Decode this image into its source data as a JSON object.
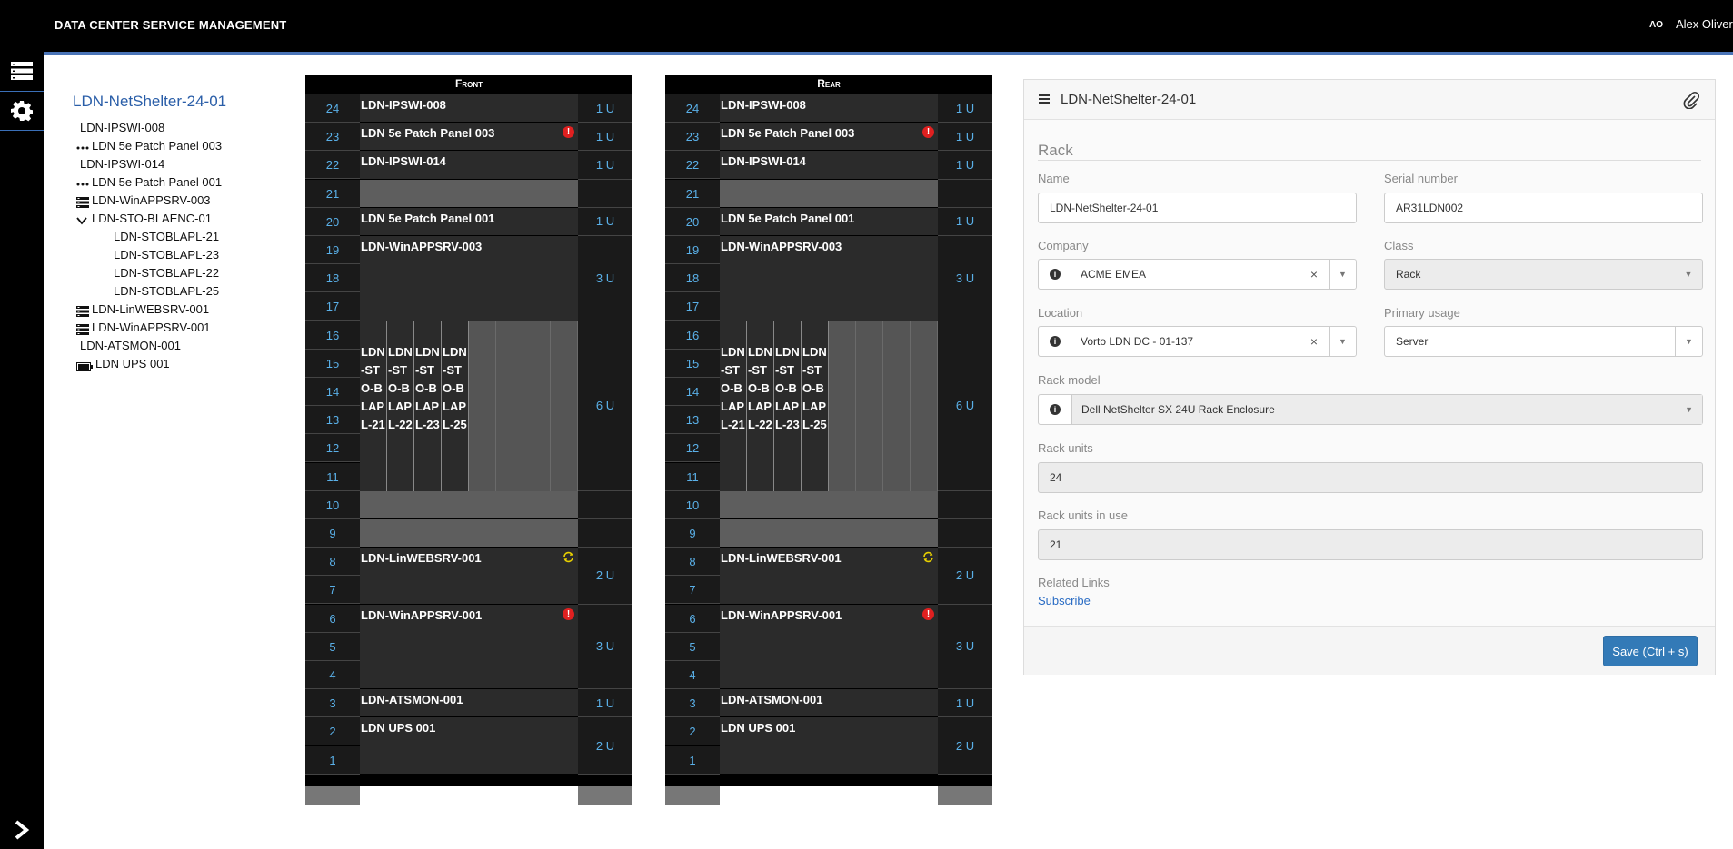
{
  "app": {
    "title": "DATA CENTER SERVICE MANAGEMENT"
  },
  "user": {
    "initials": "AO",
    "name": "Alex Oliver"
  },
  "tree": {
    "title": "LDN-NetShelter-24-01",
    "items": [
      {
        "label": "LDN-IPSWI-008",
        "icon": "none",
        "indent": 0
      },
      {
        "label": "LDN 5e Patch Panel 003",
        "icon": "patch-panel-icon",
        "indent": 0
      },
      {
        "label": "LDN-IPSWI-014",
        "icon": "none",
        "indent": 0
      },
      {
        "label": "LDN 5e Patch Panel 001",
        "icon": "patch-panel-icon",
        "indent": 0
      },
      {
        "label": "LDN-WinAPPSRV-003",
        "icon": "server-icon",
        "indent": 0
      },
      {
        "label": "LDN-STO-BLAENC-01",
        "icon": "chevron-down-icon",
        "indent": 0
      },
      {
        "label": "LDN-STOBLAPL-21",
        "icon": "none",
        "indent": 1
      },
      {
        "label": "LDN-STOBLAPL-23",
        "icon": "none",
        "indent": 1
      },
      {
        "label": "LDN-STOBLAPL-22",
        "icon": "none",
        "indent": 1
      },
      {
        "label": "LDN-STOBLAPL-25",
        "icon": "none",
        "indent": 1
      },
      {
        "label": "LDN-LinWEBSRV-001",
        "icon": "server-icon",
        "indent": 0
      },
      {
        "label": "LDN-WinAPPSRV-001",
        "icon": "server-icon",
        "indent": 0
      },
      {
        "label": "LDN-ATSMON-001",
        "icon": "none",
        "indent": 0
      },
      {
        "label": "LDN UPS 001",
        "icon": "battery-icon",
        "indent": 0
      }
    ]
  },
  "racks": {
    "front": {
      "label": "Front"
    },
    "rear": {
      "label": "Rear"
    },
    "total_units": 24,
    "devices": [
      {
        "name": "LDN-IPSWI-008",
        "top_unit": 24,
        "units": 1,
        "size": "1 U",
        "status": "none"
      },
      {
        "name": "LDN 5e Patch Panel 003",
        "top_unit": 23,
        "units": 1,
        "size": "1 U",
        "status": "error"
      },
      {
        "name": "LDN-IPSWI-014",
        "top_unit": 22,
        "units": 1,
        "size": "1 U",
        "status": "none"
      },
      {
        "name": "",
        "top_unit": 21,
        "units": 1,
        "size": "",
        "status": "empty"
      },
      {
        "name": "LDN 5e Patch Panel 001",
        "top_unit": 20,
        "units": 1,
        "size": "1 U",
        "status": "none"
      },
      {
        "name": "LDN-WinAPPSRV-003",
        "top_unit": 19,
        "units": 3,
        "size": "3 U",
        "status": "none"
      },
      {
        "name": "",
        "top_unit": 16,
        "units": 6,
        "size": "6 U",
        "status": "blade"
      },
      {
        "name": "",
        "top_unit": 10,
        "units": 1,
        "size": "",
        "status": "empty"
      },
      {
        "name": "",
        "top_unit": 9,
        "units": 1,
        "size": "",
        "status": "empty"
      },
      {
        "name": "LDN-LinWEBSRV-001",
        "top_unit": 8,
        "units": 2,
        "size": "2 U",
        "status": "sync"
      },
      {
        "name": "LDN-WinAPPSRV-001",
        "top_unit": 6,
        "units": 3,
        "size": "3 U",
        "status": "error"
      },
      {
        "name": "LDN-ATSMON-001",
        "top_unit": 3,
        "units": 1,
        "size": "1 U",
        "status": "none"
      },
      {
        "name": "LDN UPS 001",
        "top_unit": 2,
        "units": 2,
        "size": "2 U",
        "status": "none"
      }
    ],
    "blades": [
      "LDN-STO-BLAPL-21",
      "LDN-STO-BLAPL-22",
      "LDN-STO-BLAPL-23",
      "LDN-STO-BLAPL-25"
    ],
    "blade_slots": 8
  },
  "form": {
    "header_title": "LDN-NetShelter-24-01",
    "section": "Rack",
    "name": {
      "label": "Name",
      "value": "LDN-NetShelter-24-01"
    },
    "serial": {
      "label": "Serial number",
      "value": "AR31LDN002"
    },
    "company": {
      "label": "Company",
      "value": "ACME EMEA"
    },
    "class": {
      "label": "Class",
      "value": "Rack"
    },
    "location": {
      "label": "Location",
      "value": "Vorto LDN DC - 01-137"
    },
    "usage": {
      "label": "Primary usage",
      "value": "Server"
    },
    "model": {
      "label": "Rack model",
      "value": "Dell NetShelter SX 24U Rack Enclosure"
    },
    "units": {
      "label": "Rack units",
      "value": "24"
    },
    "units_in_use": {
      "label": "Rack units in use",
      "value": "21"
    },
    "related": {
      "label": "Related Links",
      "link": "Subscribe"
    },
    "save_label": "Save (Ctrl + s)"
  },
  "colors": {
    "accent": "#4a74b7",
    "rack_number": "#5ab0e8",
    "error": "#e02020",
    "sync": "#e8d000"
  }
}
